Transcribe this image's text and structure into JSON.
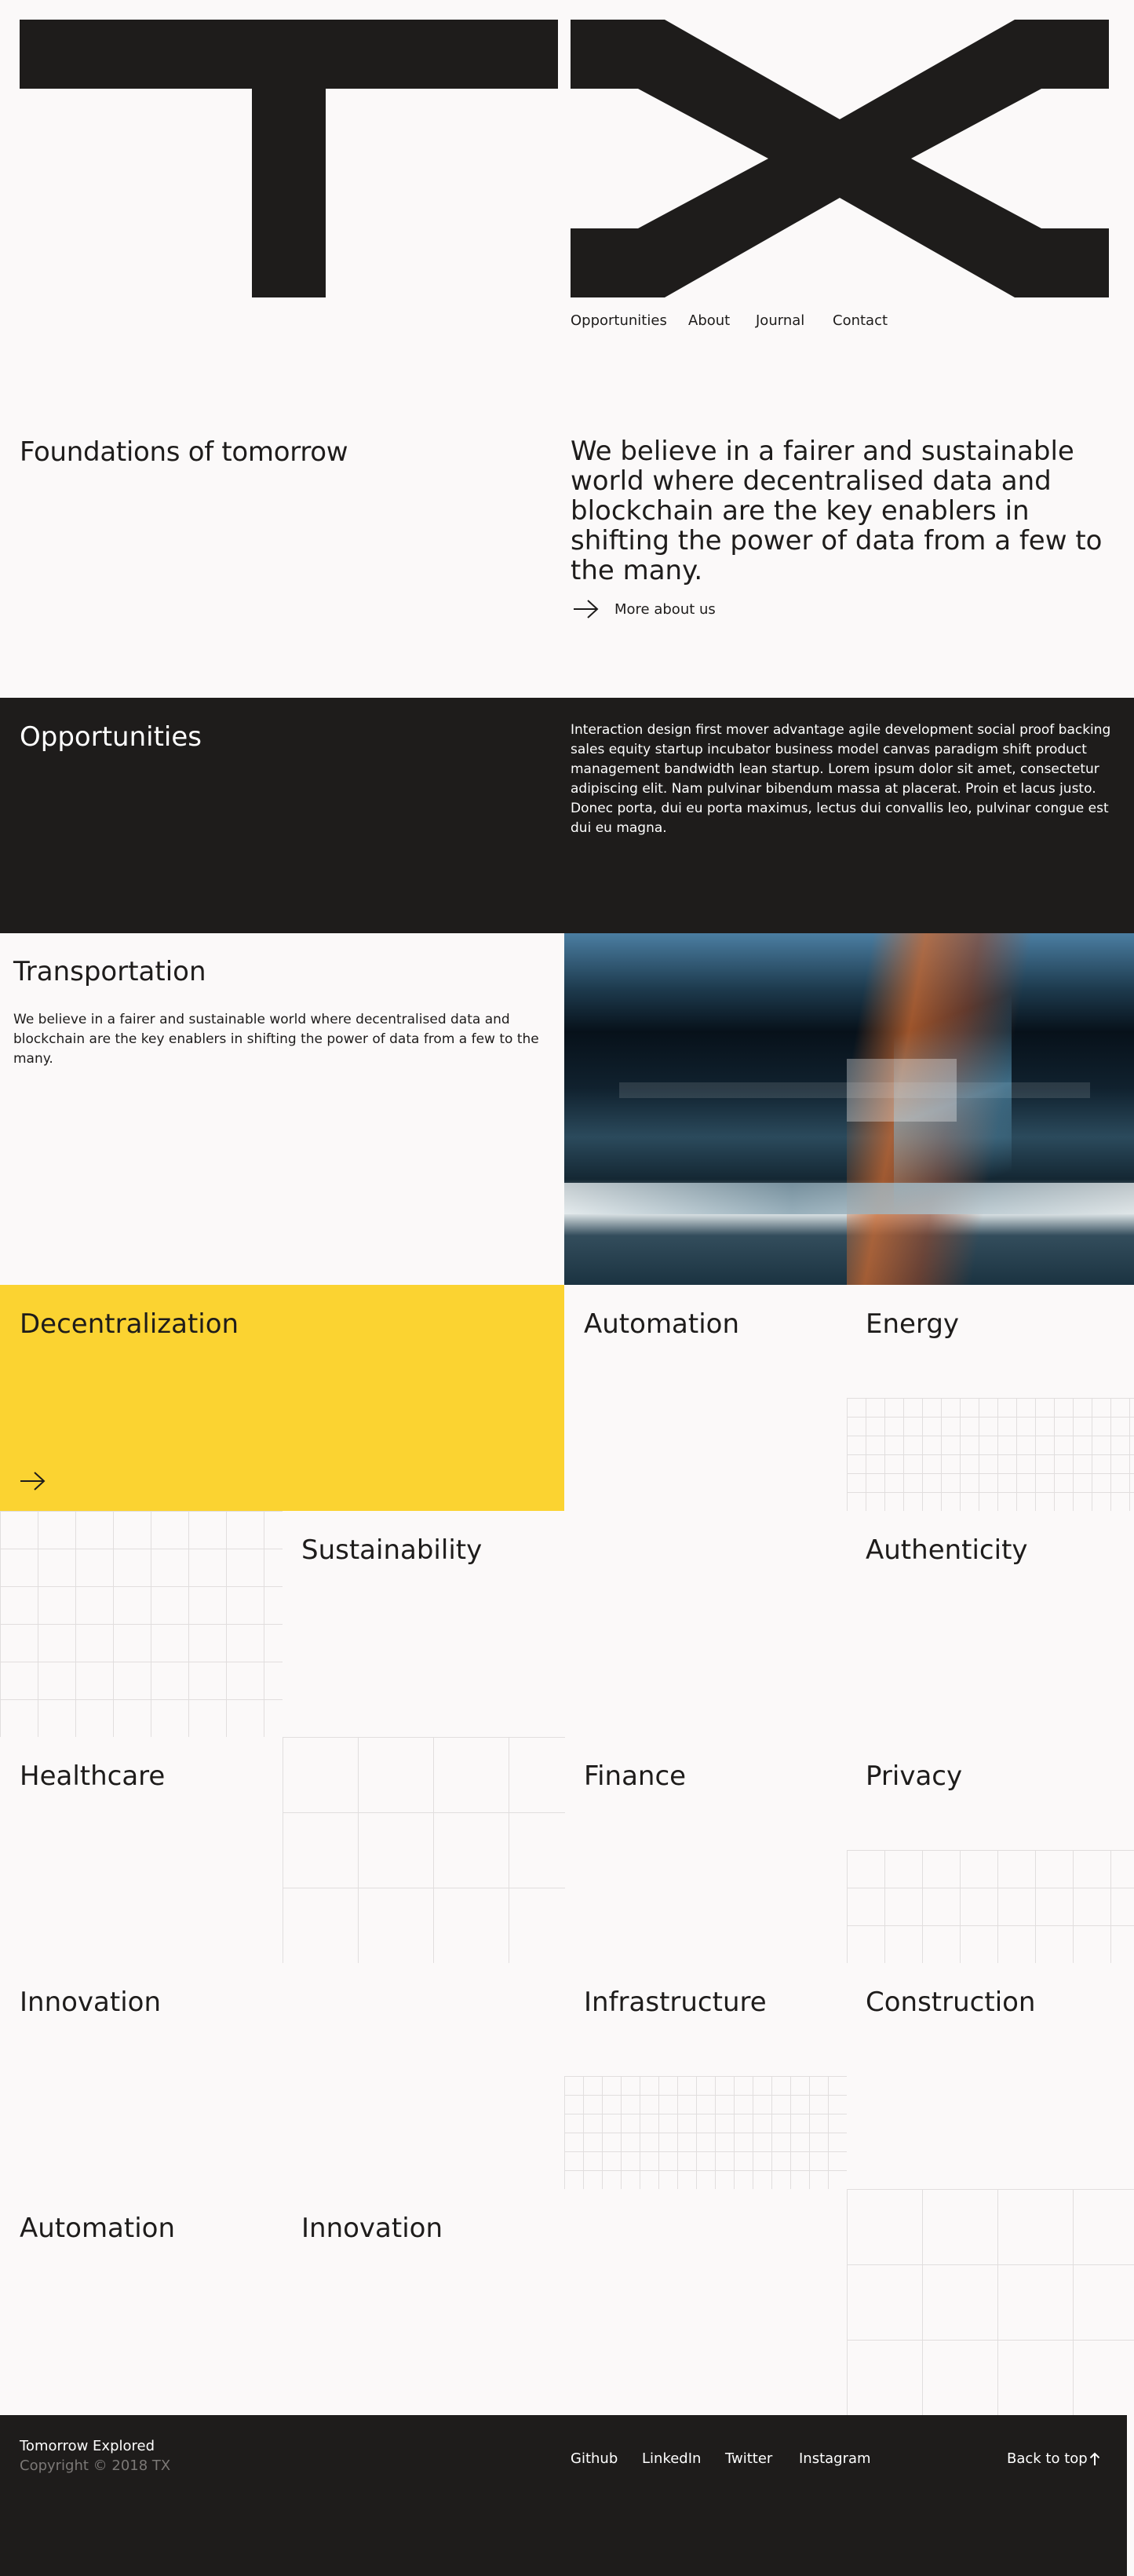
{
  "header": {
    "nav": [
      "Opportunities",
      "About",
      "Journal",
      "Contact"
    ]
  },
  "intro": {
    "heading": "Foundations of tomorrow",
    "statement": "We believe in a fairer and sustainable world where decentralised data and blockchain are the key enablers in shifting the power of data from a few to the many.",
    "link_label": "More about us"
  },
  "opportunities": {
    "heading": "Opportunities",
    "body": "Interaction design first mover advantage agile development social proof backing sales equity startup incubator business model canvas paradigm shift product management bandwidth lean startup. Lorem ipsum dolor sit amet, consectetur adipiscing elit. Nam pulvinar bibendum massa at placerat. Proin et lacus justo. Donec porta, dui eu porta maximus, lectus dui convallis leo, pulvinar congue est dui eu magna."
  },
  "feature": {
    "title": "Transportation",
    "body": "We believe in a fairer and sustainable world where decentralised data and blockchain are the key enablers in shifting the power of data from a few to the many."
  },
  "tiles": [
    "Decentralization",
    "Automation",
    "Energy",
    "Sustainability",
    "Authenticity",
    "Healthcare",
    "Finance",
    "Privacy",
    "Innovation",
    "Infrastructure",
    "Construction",
    "Automation",
    "Innovation"
  ],
  "footer": {
    "brand": "Tomorrow Explored",
    "copyright": "Copyright © 2018 TX",
    "social": [
      "Github",
      "LinkedIn",
      "Twitter",
      "Instagram"
    ],
    "back_to_top": "Back to top"
  },
  "colors": {
    "background": "#fbf9f9",
    "ink": "#1e1c1b",
    "accent": "#fbd331"
  }
}
